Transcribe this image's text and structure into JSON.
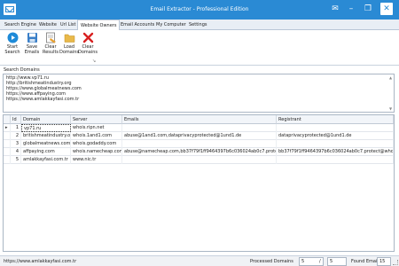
{
  "window": {
    "title": "Email Extractor - Professional Edition",
    "minimize_glyph": "–",
    "restore_glyph": "❐",
    "close_glyph": "✕",
    "extra_glyph": "✉"
  },
  "tabs": [
    {
      "label": "Search Engine",
      "active": false
    },
    {
      "label": "Website",
      "active": false
    },
    {
      "label": "Url List",
      "active": false
    },
    {
      "label": "Website Owners",
      "active": true
    },
    {
      "label": "Email Accounts",
      "active": false
    },
    {
      "label": "My Computer",
      "active": false
    },
    {
      "label": "Settings",
      "active": false
    }
  ],
  "ribbon": {
    "buttons": [
      {
        "label": "Start Search",
        "icon": "play-icon"
      },
      {
        "label": "Save Emails",
        "icon": "save-icon"
      },
      {
        "label": "Clear Results",
        "icon": "clear-results-icon"
      },
      {
        "label": "Load Domains",
        "icon": "folder-icon"
      },
      {
        "label": "Clear Domains",
        "icon": "red-x-icon"
      }
    ],
    "launcher_glyph": "↘"
  },
  "search_domains": {
    "label": "Search Domains",
    "lines": [
      "http://www.vp71.ru",
      "http://britishmeatindustry.org",
      "https://www.globalmeatnews.com",
      "https://www.affpaying.com",
      "https://www.amlakkayfasi.com.tr"
    ]
  },
  "grid": {
    "columns": [
      "Id",
      "Domain",
      "Server",
      "Emails",
      "Registrant"
    ],
    "rows": [
      {
        "id": "1",
        "domain": "vp71.ru",
        "server": "whois.ripn.net",
        "emails": "",
        "registrant": "",
        "selected": true
      },
      {
        "id": "2",
        "domain": "britishmeatindustry.org",
        "server": "whois.1and1.com",
        "emails": "abuse@1and1.com,dataprivacyprotected@1und1.de",
        "registrant": "dataprivacyprotected@1und1.de",
        "selected": false
      },
      {
        "id": "3",
        "domain": "globalmeatnews.com",
        "server": "whois.godaddy.com",
        "emails": "",
        "registrant": "",
        "selected": false
      },
      {
        "id": "4",
        "domain": "affpaying.com",
        "server": "whois.namecheap.com",
        "emails": "abuse@namecheap.com,bb37f79f1ff9464397b6c036024ab0c7.protect@whoisguard.com",
        "registrant": "bb37f79f1ff9464397b6c036024ab0c7.protect@whoisguard.com",
        "selected": false
      },
      {
        "id": "5",
        "domain": "amlakkayfasi.com.tr",
        "server": "www.nic.tr",
        "emails": "",
        "registrant": "",
        "selected": false
      }
    ]
  },
  "status": {
    "url": "https://www.amlakkayfasi.com.tr",
    "processed_label": "Processed Domains",
    "processed_value": "5",
    "separator": "/",
    "total_value": "5",
    "found_label": "Found Emails",
    "found_value": "15"
  },
  "colors": {
    "titlebar": "#2a8ad4",
    "accent": "#2a8ad4"
  }
}
